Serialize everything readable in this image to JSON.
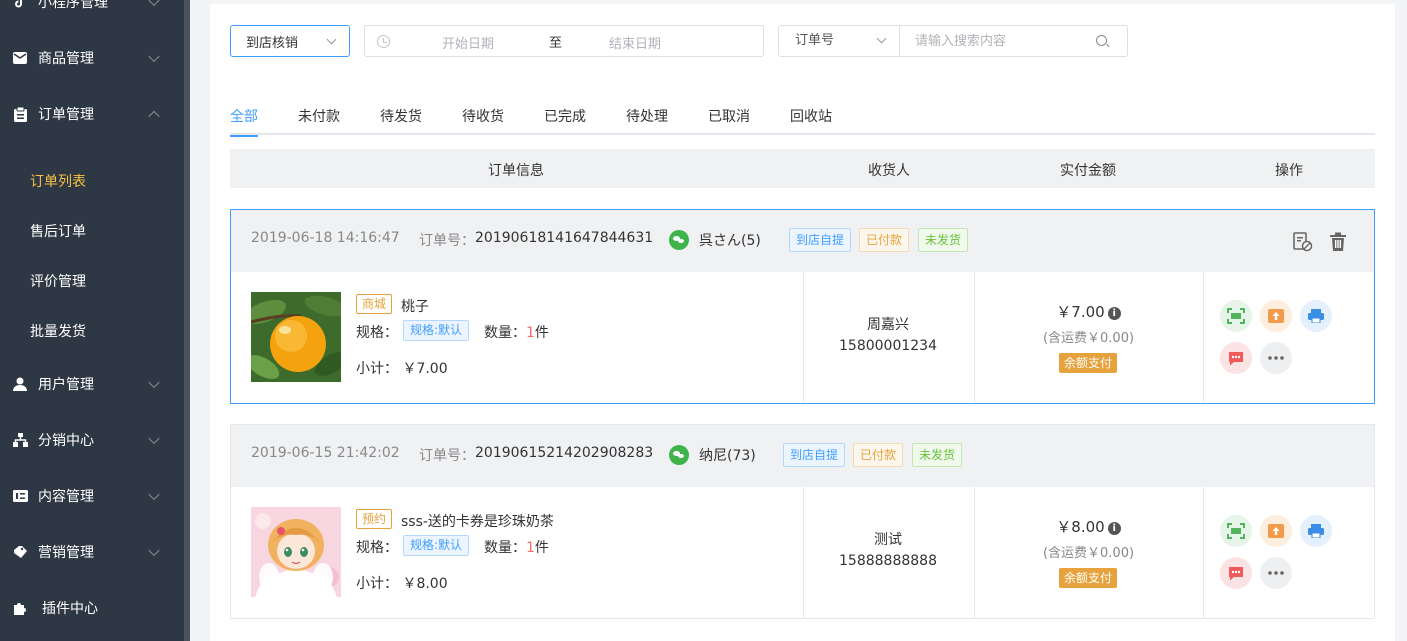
{
  "sidebar": {
    "menus": [
      {
        "label": "小程序管理",
        "icon": "tiktok-icon",
        "expanded": false
      },
      {
        "label": "商品管理",
        "icon": "mail-icon",
        "expanded": false
      },
      {
        "label": "订单管理",
        "icon": "clipboard-icon",
        "expanded": true
      },
      {
        "label": "用户管理",
        "icon": "user-icon",
        "expanded": false
      },
      {
        "label": "分销中心",
        "icon": "sitemap-icon",
        "expanded": false
      },
      {
        "label": "内容管理",
        "icon": "content-icon",
        "expanded": false
      },
      {
        "label": "营销管理",
        "icon": "marketing-icon",
        "expanded": false
      },
      {
        "label": "插件中心",
        "icon": "puzzle-icon",
        "expanded": false
      }
    ],
    "sub_items": [
      {
        "label": "订单列表",
        "active": true
      },
      {
        "label": "售后订单",
        "active": false
      },
      {
        "label": "评价管理",
        "active": false
      },
      {
        "label": "批量发货",
        "active": false
      }
    ]
  },
  "filters": {
    "type_select": "到店核销",
    "start_placeholder": "开始日期",
    "separator": "至",
    "end_placeholder": "结束日期",
    "search_type": "订单号",
    "search_placeholder": "请输入搜索内容"
  },
  "tabs": [
    "全部",
    "未付款",
    "待发货",
    "待收货",
    "已完成",
    "待处理",
    "已取消",
    "回收站"
  ],
  "active_tab": 0,
  "table_header": {
    "info": "订单信息",
    "receiver": "收货人",
    "amount": "实付金额",
    "actions": "操作"
  },
  "labels": {
    "order_no": "订单号：",
    "spec": "规格：",
    "quantity": "数量：",
    "unit": "件",
    "subtotal": "小计："
  },
  "orders": [
    {
      "time": "2019-06-18 14:16:47",
      "order_no": "20190618141647844631",
      "user": "呉さん(5)",
      "badges": [
        "到店自提",
        "已付款",
        "未发货"
      ],
      "product_type": "商城",
      "product_name": "桃子",
      "spec": "规格:默认",
      "quantity": "1",
      "subtotal": "￥7.00",
      "receiver_name": "周嘉兴",
      "receiver_phone": "15800001234",
      "amount": "￥7.00",
      "shipping": "(含运费￥0.00)",
      "payment": "余额支付"
    },
    {
      "time": "2019-06-15 21:42:02",
      "order_no": "20190615214202908283",
      "user": "纳尼(73)",
      "badges": [
        "到店自提",
        "已付款",
        "未发货"
      ],
      "product_type": "预约",
      "product_name": "sss-送的卡券是珍珠奶茶",
      "spec": "规格:默认",
      "quantity": "1",
      "subtotal": "￥8.00",
      "receiver_name": "测试",
      "receiver_phone": "15888888888",
      "amount": "￥8.00",
      "shipping": "(含运费￥0.00)",
      "payment": "余额支付"
    }
  ],
  "colors": {
    "sidebar_bg": "#2e3744",
    "accent": "#409eff",
    "active_menu": "#f5c242"
  }
}
